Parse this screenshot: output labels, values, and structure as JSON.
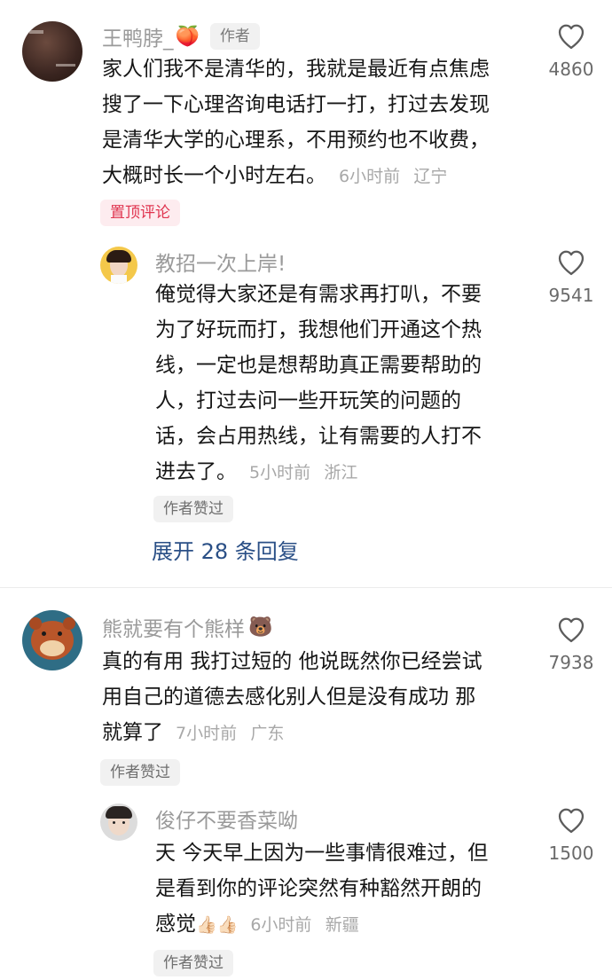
{
  "comments": [
    {
      "user": "王鸭脖_",
      "name_emoji": "🍑",
      "author_tag": "作者",
      "lines": [
        "家人们我不是清华的，我就是最近有点焦虑",
        "搜了一下心理咨询电话打一打，打过去发现",
        "是清华大学的心理系，不用预约也不收费，",
        "大概时长一个小时左右。"
      ],
      "time": "6小时前",
      "location": "辽宁",
      "pin_label": "置顶评论",
      "likes": "4860",
      "reply": {
        "user": "教招一次上岸!",
        "lines": [
          "俺觉得大家还是有需求再打叭，不要",
          "为了好玩而打，我想他们开通这个热",
          "线，一定也是想帮助真正需要帮助的",
          "人，打过去问一些开玩笑的问题的",
          "话，会占用热线，让有需要的人打不",
          "进去了。"
        ],
        "time": "5小时前",
        "location": "浙江",
        "badge": "作者赞过",
        "likes": "9541"
      },
      "expand_label": "展开 28 条回复"
    },
    {
      "user": "熊就要有个熊样",
      "name_emoji": "🐻",
      "lines": [
        "真的有用 我打过短的 他说既然你已经尝试",
        "用自己的道德去感化别人但是没有成功 那",
        "就算了"
      ],
      "time": "7小时前",
      "location": "广东",
      "badge": "作者赞过",
      "likes": "7938",
      "reply": {
        "user": "俊仔不要香菜呦",
        "lines": [
          "天 今天早上因为一些事情很难过，但",
          "是看到你的评论突然有种豁然开朗的",
          "感觉"
        ],
        "trailing_emoji": "👍🏻👍🏻",
        "time": "6小时前",
        "location": "新疆",
        "badge": "作者赞过",
        "likes": "1500"
      }
    }
  ],
  "colors": {
    "pin_text": "#e0344f",
    "pin_bg": "#fdecef",
    "expand_text": "#2a4f86",
    "name_text": "#9a9a9a",
    "meta_text": "#a8a8a8"
  },
  "icons": {
    "like": "heart-outline-icon"
  }
}
